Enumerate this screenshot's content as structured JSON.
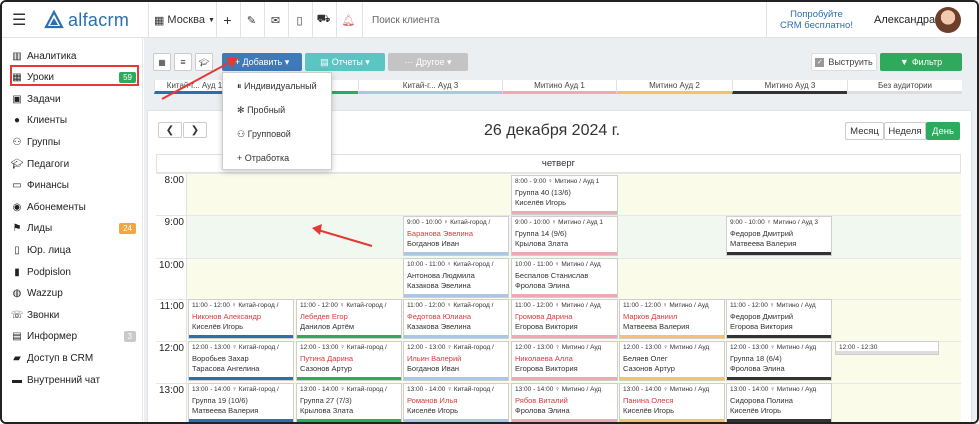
{
  "app": {
    "logo": "alfacrm"
  },
  "topbar": {
    "branch": "Москва",
    "search_placeholder": "Поиск клиента",
    "promo_line1": "Попробуйте",
    "promo_line2": "CRM бесплатно!",
    "user": "Александра"
  },
  "sidebar": {
    "items": [
      {
        "label": "Аналитика",
        "icon": "chart-icon"
      },
      {
        "label": "Уроки",
        "icon": "calendar-icon",
        "count": "59"
      },
      {
        "label": "Задачи",
        "icon": "clipboard-icon"
      },
      {
        "label": "Клиенты",
        "icon": "user-icon"
      },
      {
        "label": "Группы",
        "icon": "group-icon"
      },
      {
        "label": "Педагоги",
        "icon": "graduation-icon"
      },
      {
        "label": "Финансы",
        "icon": "money-icon"
      },
      {
        "label": "Абонементы",
        "icon": "ticket-icon"
      },
      {
        "label": "Лиды",
        "icon": "lead-icon",
        "count": "24"
      },
      {
        "label": "Юр. лица",
        "icon": "building-icon"
      },
      {
        "label": "Podpislon",
        "icon": "document-icon"
      },
      {
        "label": "Wazzup",
        "icon": "whatsapp-icon"
      },
      {
        "label": "Звонки",
        "icon": "phone-icon"
      },
      {
        "label": "Информер",
        "icon": "inbox-icon",
        "count": "3"
      },
      {
        "label": "Доступ в CRM",
        "icon": "lock-icon"
      },
      {
        "label": "Внутренний чат",
        "icon": "chat-icon"
      }
    ]
  },
  "toolbar": {
    "add": "+ Добавить ▾",
    "reports": "Отчеты ▾",
    "other": "··· Другое ▾",
    "highlight": "Выструить",
    "filter": "Фильтр"
  },
  "dropdown": {
    "items": [
      "Индивидуальный",
      "Пробный",
      "Групповой",
      "Отработка"
    ]
  },
  "rooms": [
    "Китай-г... Ауд 1",
    "Ауд 2",
    "Китай-г... Ауд 3",
    "Митино Ауд 1",
    "Митино Ауд 2",
    "Митино Ауд 3",
    "Без аудитории"
  ],
  "calendar": {
    "date": "26 декабря 2024 г.",
    "day": "четверг",
    "views": [
      "Месяц",
      "Неделя",
      "День"
    ],
    "hours": [
      "8:00",
      "9:00",
      "10:00",
      "11:00",
      "12:00",
      "13:00"
    ]
  },
  "colors": {
    "accent": "#2b6fb0",
    "green": "#2eaa5c",
    "red_outline": "#e53935"
  },
  "cards": [
    {
      "time": "8:00 - 9:00 ♀ Митино / Ауд 1",
      "title": "Группа 40 (13/6)",
      "teacher": "Киселёв Игорь",
      "bar": "#f2a8b4"
    },
    {
      "time": "9:00 - 10:00 ♀ Китай-город /",
      "title": "Баранова Эвелина",
      "teacher": "Богданов Иван",
      "bar": "#a9c7e6",
      "red": true
    },
    {
      "time": "9:00 - 10:00 ♀ Митино / Ауд 1",
      "title": "Группа 14 (9/6)",
      "teacher": "Крылова Злата",
      "bar": "#f2a8b4"
    },
    {
      "time": "9:00 - 10:00 ♀ Митино / Ауд 3",
      "title": "Федоров Дмитрий",
      "teacher": "Матвеева Валерия",
      "bar": "#333"
    },
    {
      "time": "10:00 - 11:00 ♀ Китай-город /",
      "title": "Антонова Людмила",
      "teacher": "Казакова Эвелина",
      "bar": "#a9c7e6"
    },
    {
      "time": "10:00 - 11:00 ♀ Митино / Ауд",
      "title": "Беспалов Станислав",
      "teacher": "Фролова Элина",
      "bar": "#f2a8b4"
    },
    {
      "time": "11:00 - 12:00 ♀ Китай-город /",
      "title": "Никонов Александр",
      "teacher": "Киселёв Игорь",
      "bar": "#2b6fb0",
      "red": true
    },
    {
      "time": "11:00 - 12:00 ♀ Китай-город /",
      "title": "Лебедев Егор",
      "teacher": "Данилов Артём",
      "bar": "#2eaa5c",
      "red": true
    },
    {
      "time": "11:00 - 12:00 ♀ Китай-город /",
      "title": "Федотова Юлиана",
      "teacher": "Казакова Эвелина",
      "bar": "#a9c7e6",
      "red": true
    },
    {
      "time": "11:00 - 12:00 ♀ Митино / Ауд",
      "title": "Громова Дарина",
      "teacher": "Егорова Виктория",
      "bar": "#f2a8b4",
      "red": true
    },
    {
      "time": "11:00 - 12:00 ♀ Митино / Ауд",
      "title": "Марков Даниил",
      "teacher": "Матвеева Валерия",
      "bar": "#f5c26b",
      "red": true
    },
    {
      "time": "11:00 - 12:00 ♀ Митино / Ауд",
      "title": "Федоров Дмитрий",
      "teacher": "Егорова Виктория",
      "bar": "#333"
    },
    {
      "time": "12:00 - 13:00 ♀ Китай-город /",
      "title": "Воробьев Захар",
      "teacher": "Тарасова Ангелина",
      "bar": "#2b6fb0"
    },
    {
      "time": "12:00 - 13:00 ♀ Китай-город /",
      "title": "Путина Дарина",
      "teacher": "Сазонов Артур",
      "bar": "#2eaa5c",
      "red": true
    },
    {
      "time": "12:00 - 13:00 ♀ Китай-город /",
      "title": "Ильин Валерий",
      "teacher": "Богданов Иван",
      "bar": "#a9c7e6",
      "red": true
    },
    {
      "time": "12:00 - 13:00 ♀ Митино / Ауд",
      "title": "Николаева Алла",
      "teacher": "Егорова Виктория",
      "bar": "#f2a8b4",
      "red": true
    },
    {
      "time": "12:00 - 13:00 ♀ Митино / Ауд",
      "title": "Беляев Олег",
      "teacher": "Сазонов Артур",
      "bar": "#f5c26b"
    },
    {
      "time": "12:00 - 13:00 ♀ Митино / Ауд",
      "title": "Группа 18 (6/4)",
      "teacher": "Фролова Элина",
      "bar": "#333"
    },
    {
      "time": "13:00 - 14:00 ♀ Китай-город /",
      "title": "Группа 19 (10/6)",
      "teacher": "Матвеева Валерия",
      "bar": "#2b6fb0"
    },
    {
      "time": "13:00 - 14:00 ♀ Китай-город /",
      "title": "Группа 27 (7/3)",
      "teacher": "Крылова Злата",
      "bar": "#2eaa5c"
    },
    {
      "time": "13:00 - 14:00 ♀ Китай-город /",
      "title": "Романов Илья",
      "teacher": "Киселёв Игорь",
      "bar": "#a9c7e6",
      "red": true
    },
    {
      "time": "13:00 - 14:00 ♀ Митино / Ауд",
      "title": "Рябов Виталий",
      "teacher": "Фролова Элина",
      "bar": "#f2a8b4",
      "red": true
    },
    {
      "time": "13:00 - 14:00 ♀ Митино / Ауд",
      "title": "Панина Олеся",
      "teacher": "Киселёв Игорь",
      "bar": "#f5c26b",
      "red": true
    },
    {
      "time": "13:00 - 14:00 ♀ Митино / Ауд",
      "title": "Сидорова Полина",
      "teacher": "Киселёв Игорь",
      "bar": "#333"
    },
    {
      "time": "12:00 - 12:30",
      "title": "",
      "teacher": "",
      "bar": "#ddd"
    }
  ]
}
